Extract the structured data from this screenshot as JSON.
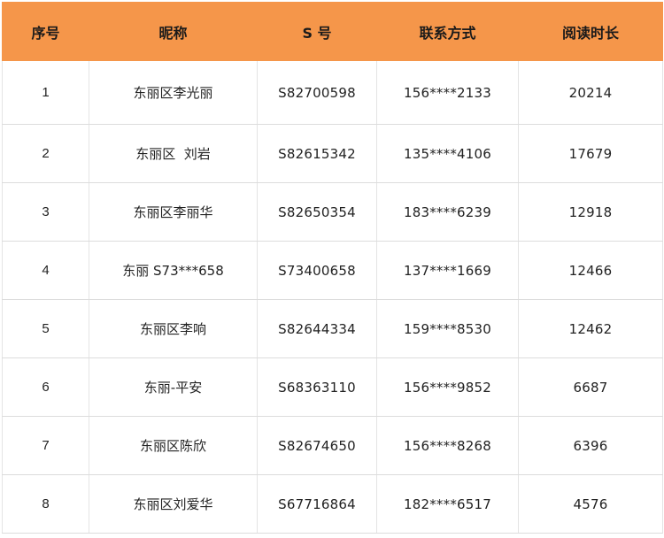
{
  "table": {
    "headers": {
      "rank": "序号",
      "nickname": "昵称",
      "s_number": "S 号",
      "contact": "联系方式",
      "reading_time": "阅读时长"
    },
    "rows": [
      {
        "rank": "1",
        "nickname": "东丽区李光丽",
        "s_number": "S82700598",
        "contact": "156****2133",
        "reading_time": "20214"
      },
      {
        "rank": "2",
        "nickname": "东丽区  刘岩",
        "s_number": "S82615342",
        "contact": "135****4106",
        "reading_time": "17679"
      },
      {
        "rank": "3",
        "nickname": "东丽区李丽华",
        "s_number": "S82650354",
        "contact": "183****6239",
        "reading_time": "12918"
      },
      {
        "rank": "4",
        "nickname": "东丽 S73***658",
        "s_number": "S73400658",
        "contact": "137****1669",
        "reading_time": "12466"
      },
      {
        "rank": "5",
        "nickname": "东丽区李响",
        "s_number": "S82644334",
        "contact": "159****8530",
        "reading_time": "12462"
      },
      {
        "rank": "6",
        "nickname": "东丽-平安",
        "s_number": "S68363110",
        "contact": "156****9852",
        "reading_time": "6687"
      },
      {
        "rank": "7",
        "nickname": "东丽区陈欣",
        "s_number": "S82674650",
        "contact": "156****8268",
        "reading_time": "6396"
      },
      {
        "rank": "8",
        "nickname": "东丽区刘爱华",
        "s_number": "S67716864",
        "contact": "182****6517",
        "reading_time": "4576"
      }
    ]
  },
  "colors": {
    "header_background": "#f5964a",
    "grid_line": "#dcdcdc"
  }
}
